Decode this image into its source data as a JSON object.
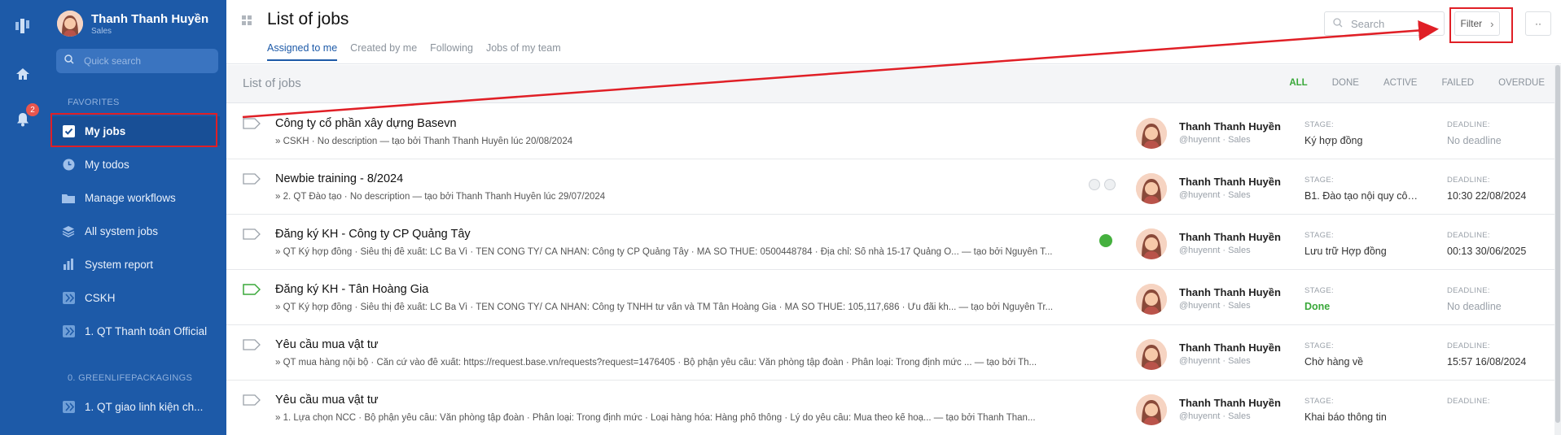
{
  "rail": {
    "notification_count": "2"
  },
  "user": {
    "name": "Thanh Thanh Huyền",
    "role": "Sales"
  },
  "sidebar": {
    "quick_search_placeholder": "Quick search",
    "favorites_title": "FAVORITES",
    "items": [
      {
        "label": "My jobs",
        "icon": "check-square-icon",
        "active": true
      },
      {
        "label": "My todos",
        "icon": "clock-icon"
      },
      {
        "label": "Manage workflows",
        "icon": "folder-icon"
      },
      {
        "label": "All system jobs",
        "icon": "layers-icon"
      },
      {
        "label": "System report",
        "icon": "bar-chart-icon"
      },
      {
        "label": "CSKH",
        "icon": "workflow-icon"
      },
      {
        "label": "1. QT Thanh toán Official",
        "icon": "workflow-icon"
      }
    ],
    "group_title": "0. GREENLIFEPACKAGINGS",
    "group_items": [
      {
        "label": "1. QT giao linh kiện ch...",
        "icon": "workflow-icon"
      }
    ]
  },
  "header": {
    "title": "List of jobs",
    "tabs": [
      "Assigned to me",
      "Created by me",
      "Following",
      "Jobs of my team"
    ],
    "search_placeholder": "Search",
    "filter_label": "Filter",
    "more_label": "··"
  },
  "list": {
    "title": "List of jobs",
    "status_tabs": [
      "ALL",
      "DONE",
      "ACTIVE",
      "FAILED",
      "OVERDUE"
    ],
    "stage_label": "STAGE:",
    "deadline_label": "DEADLINE:",
    "jobs": [
      {
        "title": "Công ty cổ phần xây dựng Basevn",
        "desc": "» CSKH · No description — tạo bởi Thanh Thanh Huyền lúc 20/08/2024",
        "assignee": "Thanh Thanh Huyền",
        "handle": "@huyennt · Sales",
        "stage": "Ký hợp đồng",
        "deadline": "No deadline"
      },
      {
        "title": "Newbie training - 8/2024",
        "desc": "» 2. QT Đào tạo · No description — tạo bởi Thanh Thanh Huyền lúc 29/07/2024",
        "assignee": "Thanh Thanh Huyền",
        "handle": "@huyennt · Sales",
        "stage": "B1. Đào tạo nội quy côn...",
        "deadline": "10:30 22/08/2024"
      },
      {
        "title": "Đăng ký KH - Công ty CP Quảng Tây",
        "desc": "» QT Ký hợp đồng · Siêu thị đề xuất: LC Ba Vì · TÊN CÔNG TY/ CÁ NHÂN: Công ty CP Quảng Tây · MÃ SỐ THUẾ: 0500448784 · Địa chỉ: Số nhà 15-17 Quảng O... — tạo bởi Nguyễn T...",
        "assignee": "Thanh Thanh Huyền",
        "handle": "@huyennt · Sales",
        "stage": "Lưu trữ Hợp đồng",
        "deadline": "00:13 30/06/2025"
      },
      {
        "title": "Đăng ký KH - Tân Hoàng Gia",
        "desc": "» QT Ký hợp đồng · Siêu thị đề xuất: LC Ba Vì · TÊN CÔNG TY/ CÁ NHÂN: Công ty TNHH tư vấn và TM Tân Hoàng Gia · MÃ SỐ THUẾ: 105,117,686 · Ưu đãi kh... — tạo bởi Nguyễn Tr...",
        "assignee": "Thanh Thanh Huyền",
        "handle": "@huyennt · Sales",
        "stage": "Done",
        "deadline": "No deadline"
      },
      {
        "title": "Yêu cầu mua vật tư",
        "desc": "» QT mua hàng nội bộ · Căn cứ vào đề xuất: https://request.base.vn/requests?request=1476405 · Bộ phận yêu cầu: Văn phòng tập đoàn · Phân loại: Trong định mức ... — tạo bởi Th...",
        "assignee": "Thanh Thanh Huyền",
        "handle": "@huyennt · Sales",
        "stage": "Chờ hàng về",
        "deadline": "15:57 16/08/2024"
      },
      {
        "title": "Yêu cầu mua vật tư",
        "desc": "» 1. Lựa chọn NCC · Bộ phận yêu cầu: Văn phòng tập đoàn · Phân loại: Trong định mức · Loại hàng hóa: Hàng phổ thông · Lý do yêu cầu: Mua theo kế hoạ... — tạo bởi Thanh Than...",
        "assignee": "Thanh Thanh Huyền",
        "handle": "@huyennt · Sales",
        "stage": "Khai báo thông tin",
        "deadline": ""
      }
    ]
  },
  "colors": {
    "brand": "#1d5aa8",
    "done": "#3aa83a",
    "annotation": "#e01f26"
  }
}
